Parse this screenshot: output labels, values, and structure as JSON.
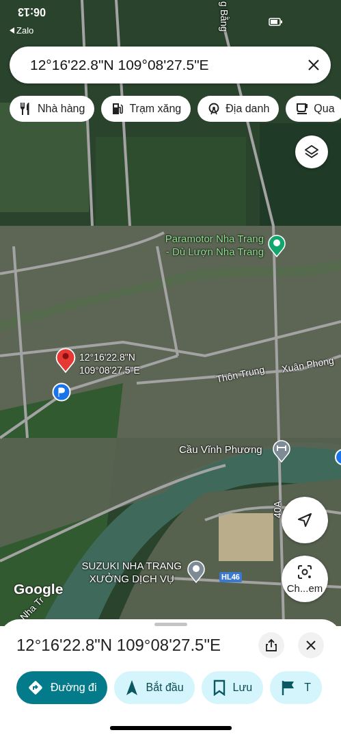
{
  "status_bar": {
    "time": "06:13",
    "back_app": "Zalo"
  },
  "search": {
    "value": "12°16'22.8\"N 109°08'27.5\"E"
  },
  "category_chips": [
    {
      "label": "Nhà hàng",
      "kind": "restaurant"
    },
    {
      "label": "Trạm xăng",
      "kind": "gas"
    },
    {
      "label": "Địa danh",
      "kind": "attraction"
    },
    {
      "label": "Qua",
      "kind": "cafe"
    }
  ],
  "map": {
    "labels": [
      {
        "kind": "road",
        "lines": [
          "g Bằng"
        ]
      },
      {
        "kind": "place",
        "lines": [
          "Paramotor Nha Trang",
          "- Dù Lượn Nha Trang"
        ]
      },
      {
        "kind": "pin",
        "lines": [
          "12°16'22.8\"N",
          "109°08'27.5\"E"
        ]
      },
      {
        "kind": "road",
        "lines": [
          "Thôn Trung"
        ]
      },
      {
        "kind": "road",
        "lines": [
          "Xuân Phong"
        ]
      },
      {
        "kind": "place",
        "lines": [
          "Cầu Vĩnh Phương"
        ]
      },
      {
        "kind": "road",
        "lines": [
          "40A"
        ]
      },
      {
        "kind": "place",
        "lines": [
          "SUZUKI NHA TRANG",
          "XƯỞNG DỊCH VỤ"
        ]
      },
      {
        "kind": "route",
        "lines": [
          "HL46"
        ]
      },
      {
        "kind": "river",
        "lines": [
          "Nha Tr"
        ]
      }
    ],
    "logo": "Google",
    "lens_button": "Ch...em"
  },
  "sheet": {
    "title": "12°16'22.8\"N 109°08'27.5\"E",
    "actions": [
      {
        "label": "Đường đi",
        "kind": "directions"
      },
      {
        "label": "Bắt đầu",
        "kind": "start"
      },
      {
        "label": "Lưu",
        "kind": "save"
      },
      {
        "label": "T",
        "kind": "flag"
      }
    ]
  }
}
